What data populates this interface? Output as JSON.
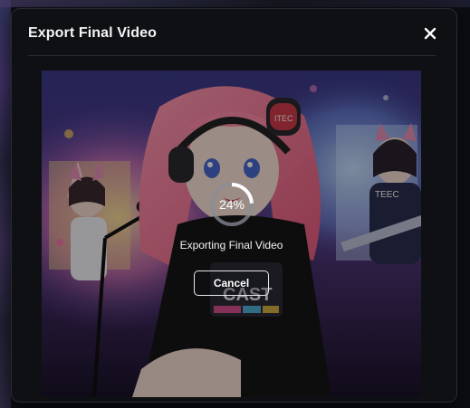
{
  "modal": {
    "title": "Export Final Video",
    "close_icon": "close-icon"
  },
  "export": {
    "progress_percent": 24,
    "progress_label": "24%",
    "status": "Exporting Final Video",
    "cancel_label": "Cancel"
  },
  "preview": {
    "shirt_text": "CAST",
    "headphone_text": "ITEC",
    "guitar_shirt_text": "TEEC"
  },
  "colors": {
    "modal_bg": "#0f1014",
    "modal_border": "#2a2c33",
    "title": "#f4f4f6",
    "progress_track": "#8a8d98",
    "progress_fill": "#ffffff"
  }
}
